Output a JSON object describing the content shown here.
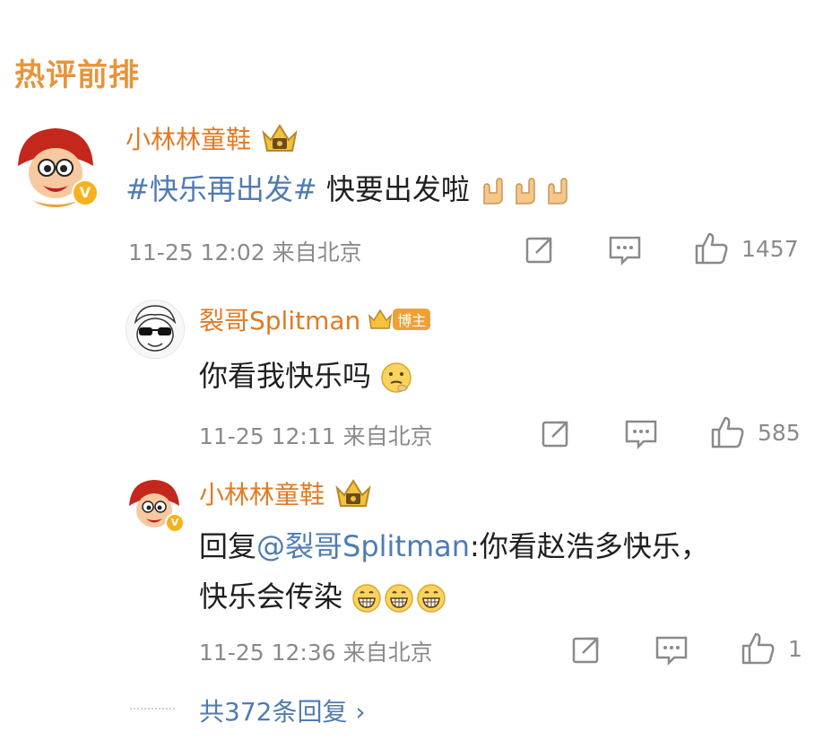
{
  "section": {
    "title": "热评前排"
  },
  "comments": [
    {
      "author": "小林林童鞋",
      "hashtag": "#快乐再出发#",
      "text": " 快要出发啦",
      "time": "11-25 12:02 来自北京",
      "likes": "1457",
      "emoji": "rock-hand"
    },
    {
      "author": "裂哥Splitman",
      "badge": "博主",
      "text": "你看我快乐吗",
      "time": "11-25 12:11 来自北京",
      "likes": "585",
      "emoji": "thinking-face"
    },
    {
      "author": "小林林童鞋",
      "reply_prefix": "回复",
      "mention": "@裂哥Splitman",
      "text_line1": ":你看赵浩多快乐，",
      "text_line2": "快乐会传染",
      "time": "11-25 12:36 来自北京",
      "likes": "1",
      "emoji": "grinning-face"
    }
  ],
  "footer": {
    "more_replies": "共372条回复 ›"
  },
  "icons": {
    "repost": "share-icon",
    "comment": "comment-icon",
    "like": "thumbs-up-icon",
    "crown": "crown-badge-icon"
  },
  "colors": {
    "accent_orange": "#e17a24",
    "title_orange": "#e8943a",
    "link_blue": "#4f7bb2",
    "meta_gray": "#8a8a8a"
  }
}
